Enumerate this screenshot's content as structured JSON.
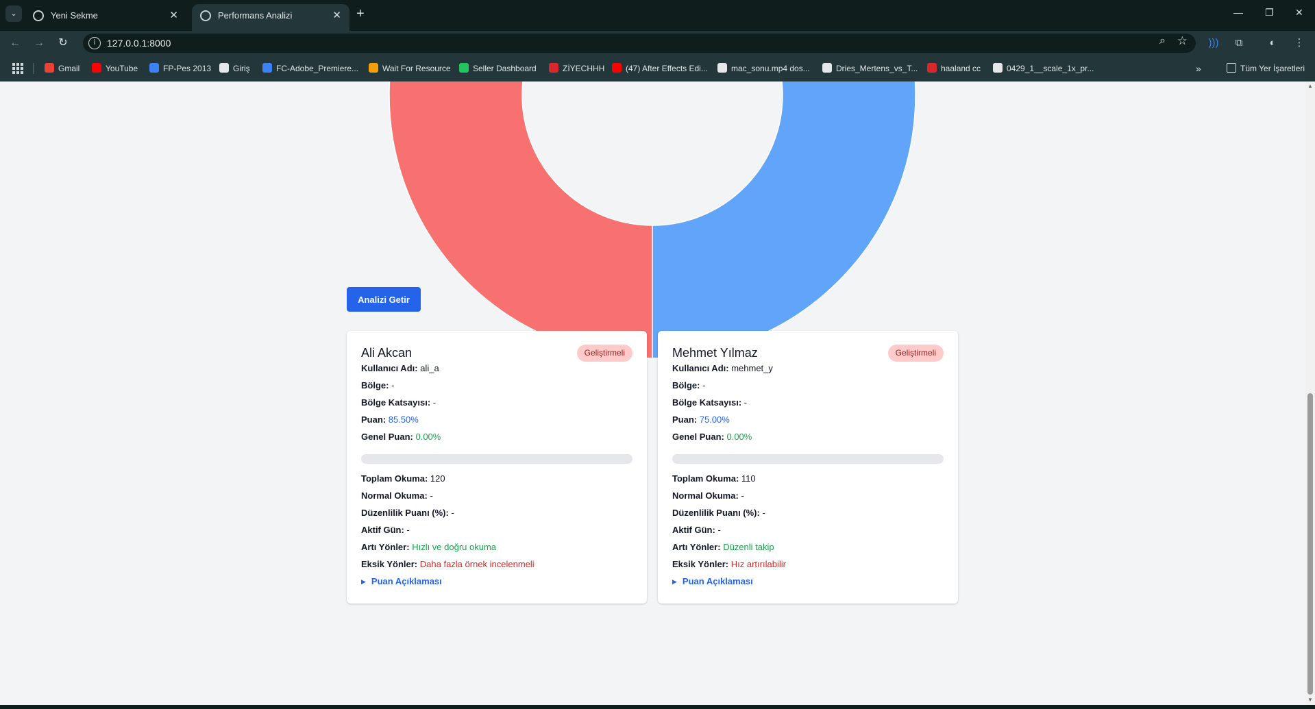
{
  "browser": {
    "tabs": [
      {
        "title": "Yeni Sekme",
        "active": false
      },
      {
        "title": "Performans Analizi",
        "active": true
      }
    ],
    "url": "127.0.0.1:8000",
    "bookmarks": [
      {
        "label": "Gmail",
        "icon": "gmail-icon",
        "color": "#ea4335"
      },
      {
        "label": "YouTube",
        "icon": "youtube-icon",
        "color": "#ff0000"
      },
      {
        "label": "FP-Pes 2013",
        "icon": "fp-icon",
        "color": "#3b82f6"
      },
      {
        "label": "Giriş",
        "icon": "giris-icon",
        "color": "#e5e7eb"
      },
      {
        "label": "FC-Adobe_Premiere...",
        "icon": "fc-icon",
        "color": "#3b82f6"
      },
      {
        "label": "Wait For Resource",
        "icon": "google-icon",
        "color": "#f59e0b"
      },
      {
        "label": "Seller Dashboard",
        "icon": "seller-icon",
        "color": "#22c55e"
      },
      {
        "label": "ZİYECHHH",
        "icon": "mega-icon",
        "color": "#d9272e"
      },
      {
        "label": "(47) After Effects Edi...",
        "icon": "youtube-icon",
        "color": "#ff0000"
      },
      {
        "label": "mac_sonu.mp4 dos...",
        "icon": "drive-icon",
        "color": "#e5e7eb"
      },
      {
        "label": "Dries_Mertens_vs_T...",
        "icon": "drive-icon",
        "color": "#e5e7eb"
      },
      {
        "label": "haaland cc",
        "icon": "mega-icon",
        "color": "#d9272e"
      },
      {
        "label": "0429_1__scale_1x_pr...",
        "icon": "drive-icon",
        "color": "#e5e7eb"
      }
    ],
    "all_bookmarks": "Tüm Yer İşaretleri"
  },
  "chart_data": {
    "type": "pie",
    "slices": [
      {
        "value": 50,
        "color": "#f87171"
      },
      {
        "value": 50,
        "color": "#60a5fa"
      }
    ],
    "donut": true
  },
  "analyze_button": "Analizi Getir",
  "cards": [
    {
      "name": "Ali Akcan",
      "badge": "Geliştirmeli",
      "username_label": "Kullanıcı Adı:",
      "username": "ali_a",
      "region_label": "Bölge:",
      "region": "-",
      "region_coef_label": "Bölge Katsayısı:",
      "region_coef": "-",
      "score_label": "Puan:",
      "score": "85.50%",
      "general_label": "Genel Puan:",
      "general": "0.00%",
      "general_fraction": 0.0,
      "total_label": "Toplam Okuma:",
      "total": "120",
      "normal_label": "Normal Okuma:",
      "normal": "-",
      "regularity_label": "Düzenlilik Puanı (%):",
      "regularity": "-",
      "active_label": "Aktif Gün:",
      "active": "-",
      "plus_label": "Artı Yönler:",
      "plus": "Hızlı ve doğru okuma",
      "minus_label": "Eksik Yönler:",
      "minus": "Daha fazla örnek incelenmeli",
      "details": "Puan Açıklaması"
    },
    {
      "name": "Mehmet Yılmaz",
      "badge": "Geliştirmeli",
      "username_label": "Kullanıcı Adı:",
      "username": "mehmet_y",
      "region_label": "Bölge:",
      "region": "-",
      "region_coef_label": "Bölge Katsayısı:",
      "region_coef": "-",
      "score_label": "Puan:",
      "score": "75.00%",
      "general_label": "Genel Puan:",
      "general": "0.00%",
      "general_fraction": 0.0,
      "total_label": "Toplam Okuma:",
      "total": "110",
      "normal_label": "Normal Okuma:",
      "normal": "-",
      "regularity_label": "Düzenlilik Puanı (%):",
      "regularity": "-",
      "active_label": "Aktif Gün:",
      "active": "-",
      "plus_label": "Artı Yönler:",
      "plus": "Düzenli takip",
      "minus_label": "Eksik Yönler:",
      "minus": "Hız artırılabilir",
      "details": "Puan Açıklaması"
    }
  ]
}
